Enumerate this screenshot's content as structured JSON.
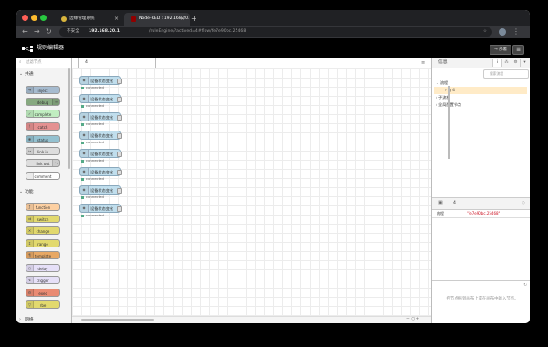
{
  "browser": {
    "tabs": [
      {
        "label": "边缘管理系统",
        "close": "×",
        "fav_color": "#d9b53d"
      },
      {
        "label": "Node-RED : 192.168.20.1",
        "close": "×",
        "fav_color": "#8f0000"
      }
    ],
    "new_tab": "+",
    "nav": {
      "back": "←",
      "forward": "→",
      "reload": "↻"
    },
    "address": {
      "security": "不安全",
      "host": "192.168.20.1",
      "path": "/ruleEngine/?actived=4#flow/fe7e90bc.25468",
      "star": "☆"
    },
    "menu": "⋮"
  },
  "app": {
    "title": "规则编辑器",
    "deploy_label": "⊸ 部署",
    "menu_label": "≡"
  },
  "palette": {
    "search_placeholder": "过滤节点",
    "search_icon": "⌕",
    "categories": [
      {
        "caret": "⌄",
        "name": "共通"
      },
      {
        "caret": "⌄",
        "name": "功能"
      },
      {
        "caret": "›",
        "name": "网络"
      }
    ],
    "common_nodes": [
      {
        "label": "inject",
        "color": "#a6bbcf"
      },
      {
        "label": "debug",
        "color": "#87a980"
      },
      {
        "label": "complete",
        "color": "#c0edc0"
      },
      {
        "label": "catch",
        "color": "#e49191"
      },
      {
        "label": "status",
        "color": "#94c1d0"
      },
      {
        "label": "link in",
        "color": "#dddddd"
      },
      {
        "label": "link out",
        "color": "#dddddd"
      },
      {
        "label": "comment",
        "color": "#ffffff"
      }
    ],
    "function_nodes": [
      {
        "label": "function",
        "color": "#fdd0a2"
      },
      {
        "label": "switch",
        "color": "#e2d96e"
      },
      {
        "label": "change",
        "color": "#e2d96e"
      },
      {
        "label": "range",
        "color": "#e2d96e"
      },
      {
        "label": "template",
        "color": "#e7a865"
      },
      {
        "label": "delay",
        "color": "#e6e0f8"
      },
      {
        "label": "trigger",
        "color": "#e6e0f8"
      },
      {
        "label": "exec",
        "color": "#e98b73"
      },
      {
        "label": "rbe",
        "color": "#e2d96e"
      }
    ]
  },
  "workspace": {
    "flow_tab": "4",
    "tab_menu": "≡",
    "nodes": [
      {
        "label": "设备状态变化",
        "status": "connected"
      },
      {
        "label": "设备状态变化",
        "status": "connected"
      },
      {
        "label": "设备状态变化",
        "status": "connected"
      },
      {
        "label": "设备状态变化",
        "status": "connected"
      },
      {
        "label": "设备状态变化",
        "status": "connected"
      },
      {
        "label": "设备状态变化",
        "status": "connected"
      },
      {
        "label": "设备状态变化",
        "status": "connected"
      },
      {
        "label": "设备状态变化",
        "status": "connected"
      }
    ],
    "zoom_controls": "− ○ +"
  },
  "sidebar": {
    "title": "信息",
    "icon_info": "i",
    "icon_debug": "⁂",
    "icon_config": "⚙",
    "icon_more": "▾",
    "search_placeholder": "搜索流程",
    "tree": {
      "flows_label": "流程",
      "flow_item": "4",
      "subflows_label": "子流程",
      "global_config_label": "全局配置节点"
    },
    "info_panel": {
      "title": "4",
      "key": "流程",
      "value": "\"fe7e90bc.25468\""
    },
    "help_text": "把节点拖到画布上或在画布中输入节点。"
  }
}
